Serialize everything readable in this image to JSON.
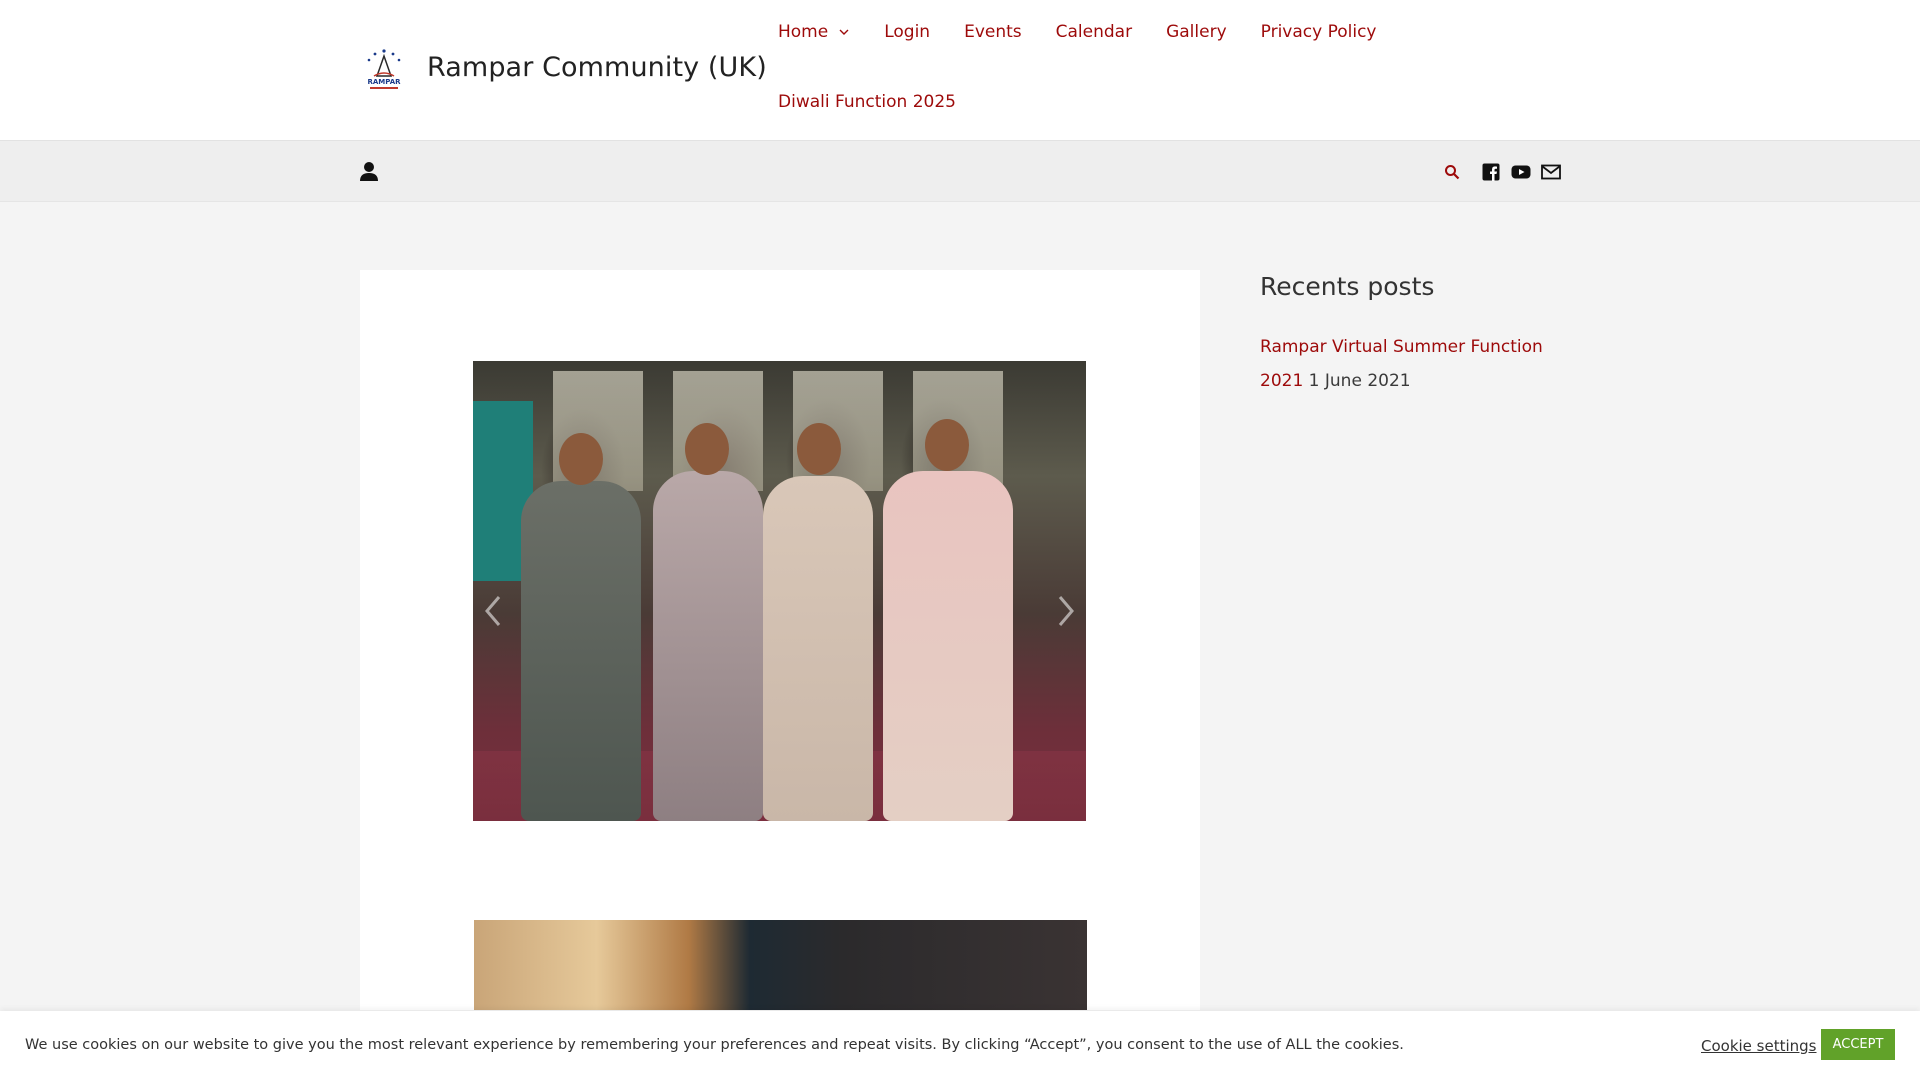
{
  "header": {
    "site_title": "Rampar Community (UK)",
    "logo_text": "RAMPAR",
    "nav": [
      {
        "label": "Home",
        "has_dropdown": true
      },
      {
        "label": "Login"
      },
      {
        "label": "Events"
      },
      {
        "label": "Calendar"
      },
      {
        "label": "Gallery"
      },
      {
        "label": "Privacy Policy"
      },
      {
        "label": "Diwali Function 2025"
      }
    ]
  },
  "toolbar": {
    "icons": [
      "user-icon",
      "search-icon",
      "facebook-icon",
      "youtube-icon",
      "mail-icon"
    ]
  },
  "sidebar": {
    "title": "Recents posts",
    "posts": [
      {
        "title": "Rampar Virtual Summer Function 2021",
        "date": "1 June 2021"
      }
    ]
  },
  "cookie": {
    "text": "We use cookies on our website to give you the most relevant experience by remembering your preferences and repeat visits. By clicking “Accept”, you consent to the use of ALL the cookies.",
    "settings_label": "Cookie settings",
    "accept_label": "ACCEPT"
  },
  "colors": {
    "accent": "#9d0a0a",
    "accept_button": "#61a229",
    "toolbar_bg": "#eeeeee",
    "page_bg": "#f4f4f4"
  }
}
